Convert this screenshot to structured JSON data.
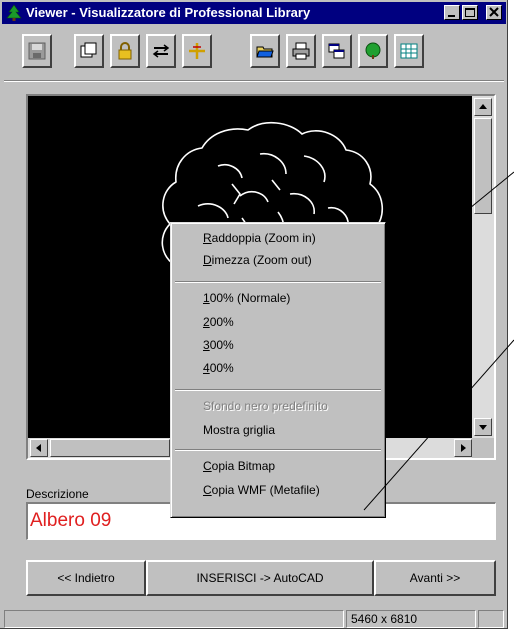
{
  "window": {
    "title": "Viewer - Visualizzatore di Professional Library",
    "controls": [
      "minimize-icon",
      "maximize-icon",
      "close-icon"
    ]
  },
  "toolbar": {
    "tools": [
      {
        "name": "save-icon"
      },
      {
        "name": "copy-icon"
      },
      {
        "name": "lock-icon"
      },
      {
        "name": "pan-icon"
      },
      {
        "name": "crosshair-icon"
      },
      {
        "name": "open-folder-icon"
      },
      {
        "name": "print-icon"
      },
      {
        "name": "windows-icon"
      },
      {
        "name": "tree-icon"
      },
      {
        "name": "grid-icon"
      }
    ]
  },
  "context_menu": {
    "items": [
      {
        "accel": "R",
        "rest": "addoppia (Zoom in)",
        "enabled": true
      },
      {
        "accel": "D",
        "rest": "imezza (Zoom out)",
        "enabled": true
      },
      {
        "accel": "1",
        "rest": "00% (Normale)",
        "enabled": true
      },
      {
        "accel": "2",
        "rest": "00%",
        "enabled": true
      },
      {
        "accel": "3",
        "rest": "00%",
        "enabled": true
      },
      {
        "accel": "4",
        "rest": "00%",
        "enabled": true
      },
      {
        "accel": "",
        "rest": "Sfondo nero predefinito",
        "enabled": false
      },
      {
        "accel": "",
        "rest": "Mostra griglia",
        "enabled": true
      },
      {
        "accel": "C",
        "rest": "opia Bitmap",
        "enabled": true
      },
      {
        "accel": "C",
        "rest": "opia WMF (Metafile)",
        "enabled": true
      }
    ]
  },
  "description": {
    "label": "Descrizione",
    "value": "Albero 09",
    "value_color": "#e02020"
  },
  "buttons": {
    "back": "<< Indietro",
    "insert": "INSERISCI -> AutoCAD",
    "next": "Avanti >>"
  },
  "status": {
    "dimensions": "5460 x 6810"
  },
  "colors": {
    "titlebar": "#000080",
    "canvas": "#000000",
    "drawing_stroke": "#ffffff"
  }
}
